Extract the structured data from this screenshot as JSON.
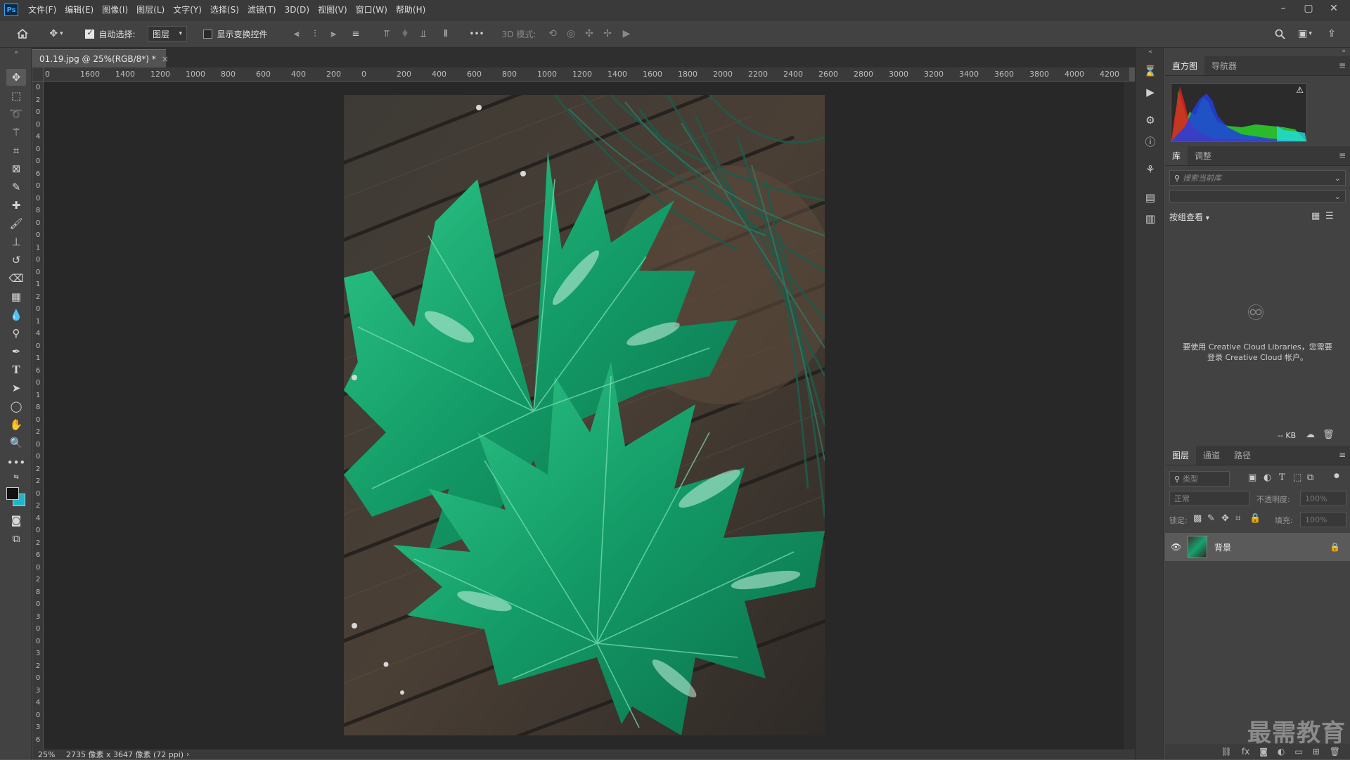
{
  "app": {
    "logo": "Ps"
  },
  "menu": [
    "文件(F)",
    "编辑(E)",
    "图像(I)",
    "图层(L)",
    "文字(Y)",
    "选择(S)",
    "滤镜(T)",
    "3D(D)",
    "视图(V)",
    "窗口(W)",
    "帮助(H)"
  ],
  "window_controls": {
    "minimize": "–",
    "maximize": "▢",
    "close": "✕"
  },
  "options": {
    "auto_select_label": "自动选择:",
    "auto_select_checked": true,
    "target_value": "图层",
    "show_transform_label": "显示变换控件",
    "show_transform_checked": false,
    "mode_3d_label": "3D 模式:",
    "more": "•••"
  },
  "document": {
    "tab_title": "01.19.jpg @ 25%(RGB/8*) *",
    "close": "×",
    "zoom": "25%",
    "info": "2735 像素 x 3647 像素 (72 ppi)"
  },
  "ruler": {
    "h_ticks": [
      "0",
      "1600",
      "1400",
      "1200",
      "1000",
      "800",
      "600",
      "400",
      "200",
      "0",
      "200",
      "400",
      "600",
      "800",
      "1000",
      "1200",
      "1400",
      "1600",
      "1800",
      "2000",
      "2200",
      "2400",
      "2600",
      "2800",
      "3000",
      "3200",
      "3400",
      "3600",
      "3800",
      "4000",
      "4200",
      "4"
    ],
    "v_ticks": [
      "0",
      "2",
      "0",
      "0",
      "4",
      "0",
      "0",
      "6",
      "0",
      "0",
      "8",
      "0",
      "0",
      "1",
      "0",
      "0",
      "1",
      "2",
      "0",
      "1",
      "4",
      "0",
      "1",
      "6",
      "0",
      "1",
      "8",
      "0",
      "2",
      "0",
      "0",
      "2",
      "2",
      "0",
      "2",
      "4",
      "0",
      "2",
      "6",
      "0",
      "2",
      "8",
      "0",
      "3",
      "0",
      "0",
      "3",
      "2",
      "0",
      "3",
      "4",
      "0",
      "3",
      "6"
    ]
  },
  "panels": {
    "histogram": {
      "tabs": [
        "直方图",
        "导航器"
      ],
      "warning": "⚠"
    },
    "library": {
      "tabs": [
        "库",
        "调整"
      ],
      "search_placeholder": "搜索当前库",
      "view_label": "按组查看",
      "message": "要使用 Creative Cloud Libraries，您需要登录 Creative Cloud 帐户。",
      "size": "-- KB"
    },
    "layers": {
      "tabs": [
        "图层",
        "通道",
        "路径"
      ],
      "filter_placeholder": "类型",
      "blend_mode": "正常",
      "opacity_label": "不透明度:",
      "opacity_value": "100%",
      "lock_label": "锁定:",
      "fill_label": "填充:",
      "fill_value": "100%",
      "layer_name": "背景"
    }
  },
  "watermark": "最需教育",
  "colors": {
    "foreground": "#111111",
    "background": "#1fb6c9",
    "accent": "#31a8ff"
  }
}
